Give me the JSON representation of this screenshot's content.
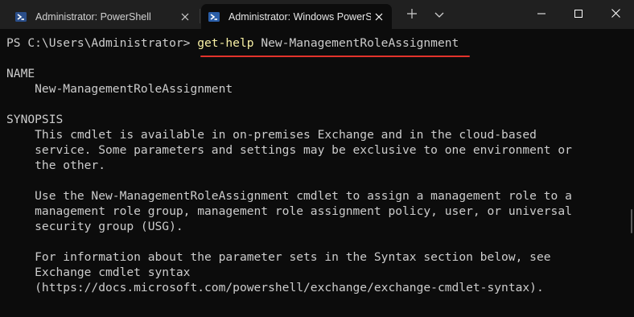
{
  "tabs": [
    {
      "label": "Administrator: PowerShell",
      "active": false
    },
    {
      "label": "Administrator: Windows PowerShell",
      "active": true
    }
  ],
  "colors": {
    "titlebar": "#202020",
    "terminal_bg": "#0c0c0c",
    "text": "#cccccc",
    "command": "#f9f1a5",
    "underline": "#e3332c"
  },
  "icons": {
    "tab_icon": "powershell-icon",
    "close": "close-icon",
    "new_tab": "plus-icon",
    "dropdown": "chevron-down-icon",
    "minimize": "minimize-icon",
    "maximize": "maximize-icon",
    "window_close": "close-icon"
  },
  "terminal": {
    "prompt": "PS C:\\Users\\Administrator> ",
    "command": "get-help",
    "argument": " New-ManagementRoleAssignment",
    "lines": [
      "NAME",
      "    New-ManagementRoleAssignment",
      "",
      "SYNOPSIS",
      "    This cmdlet is available in on-premises Exchange and in the cloud-based",
      "    service. Some parameters and settings may be exclusive to one environment or",
      "    the other.",
      "",
      "    Use the New-ManagementRoleAssignment cmdlet to assign a management role to a",
      "    management role group, management role assignment policy, user, or universal",
      "    security group (USG).",
      "",
      "    For information about the parameter sets in the Syntax section below, see",
      "    Exchange cmdlet syntax",
      "    (https://docs.microsoft.com/powershell/exchange/exchange-cmdlet-syntax)."
    ]
  }
}
